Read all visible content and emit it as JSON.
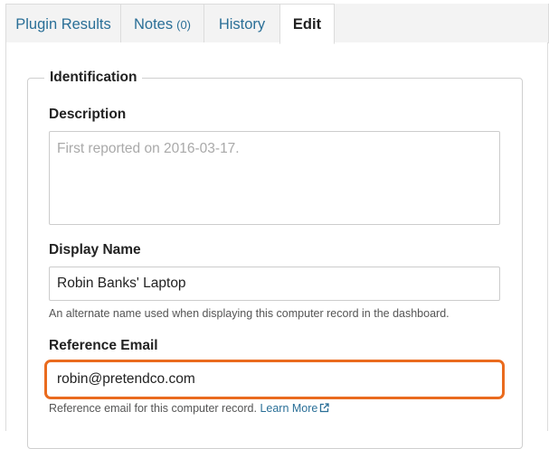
{
  "tabs": [
    {
      "label": "Plugin Results",
      "count": "",
      "active": false
    },
    {
      "label": "Notes",
      "count": "(0)",
      "active": false
    },
    {
      "label": "History",
      "count": "",
      "active": false
    },
    {
      "label": "Edit",
      "count": "",
      "active": true
    }
  ],
  "fieldset": {
    "legend": "Identification"
  },
  "description": {
    "label": "Description",
    "placeholder": "First reported on 2016-03-17.",
    "value": ""
  },
  "display_name": {
    "label": "Display Name",
    "value": "Robin Banks' Laptop",
    "help": "An alternate name used when displaying this computer record in the dashboard."
  },
  "reference_email": {
    "label": "Reference Email",
    "value": "robin@pretendco.com",
    "help": "Reference email for this computer record.",
    "link_label": "Learn More",
    "link_icon": "external-link-icon"
  },
  "colors": {
    "accent": "#2a6f97",
    "highlight_border": "#ea6b1e",
    "tab_background": "#f3f3f3"
  }
}
